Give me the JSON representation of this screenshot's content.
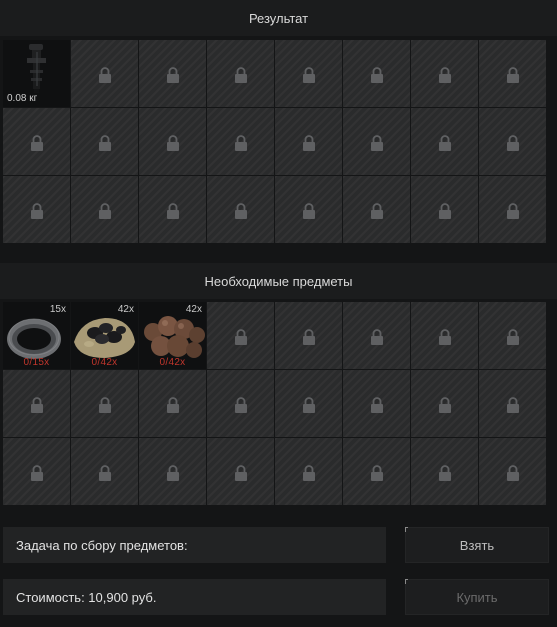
{
  "result": {
    "title": "Результат",
    "item": {
      "weight": "0.08 кг",
      "icon": "scope-mount-icon"
    }
  },
  "required": {
    "title": "Необходимые предметы",
    "items": [
      {
        "icon": "tape-roll-icon",
        "count": "15x",
        "progress": "0/15x"
      },
      {
        "icon": "coal-pile-icon",
        "count": "42x",
        "progress": "0/42x"
      },
      {
        "icon": "mushrooms-icon",
        "count": "42x",
        "progress": "0/42x"
      }
    ]
  },
  "task": {
    "label": "Задача по сбору предметов:"
  },
  "cost": {
    "label": "Стоимость: 10,900 руб."
  },
  "buttons": {
    "take": "Взять",
    "buy": "Купить"
  },
  "colors": {
    "need_red": "#c0362c",
    "cell_bg": "#2a2b2c",
    "panel_bg": "#141516"
  }
}
